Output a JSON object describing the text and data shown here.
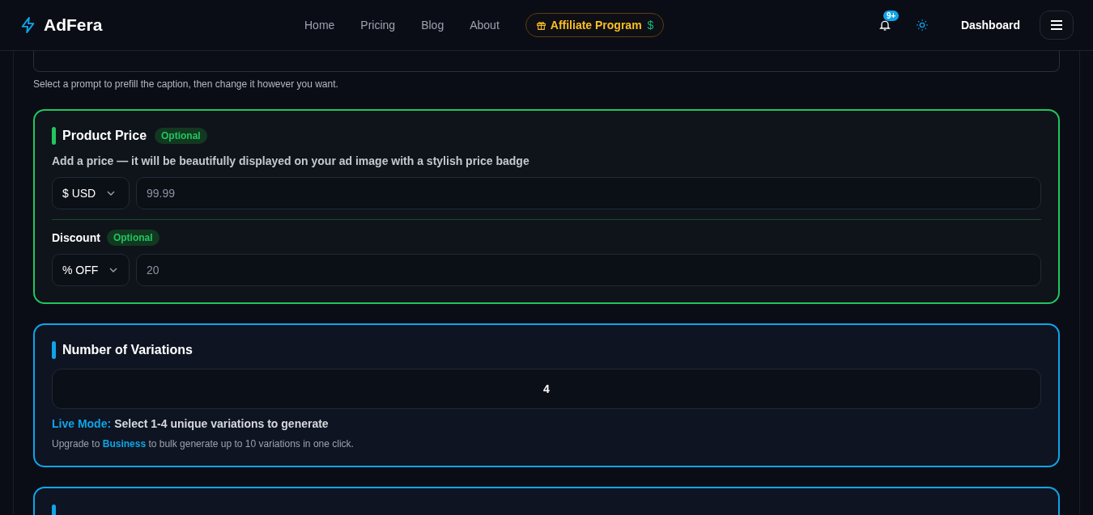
{
  "header": {
    "brand": "AdFera",
    "nav": [
      {
        "label": "Home"
      },
      {
        "label": "Pricing"
      },
      {
        "label": "Blog"
      },
      {
        "label": "About"
      }
    ],
    "affiliate": {
      "label": "Affiliate Program",
      "symbol": "$"
    },
    "notifications_badge": "9+",
    "dashboard": "Dashboard"
  },
  "caption_hint": "Select a prompt to prefill the caption, then change it however you want.",
  "sections": [
    {
      "kind": "price",
      "color": "#22c55e",
      "title": "Product Price",
      "badge": "Optional",
      "description": "Add a price — it will be beautifully displayed on your ad image with a stylish price badge",
      "currency": "$ USD",
      "price_value": "99.99",
      "discount_label": "Discount",
      "discount_badge": "Optional",
      "discount_type": "% OFF",
      "discount_value": "20"
    },
    {
      "kind": "variations",
      "color": "#0ea5e9",
      "title": "Number of Variations",
      "value": "4",
      "mode_label": "Live Mode:",
      "mode_text": "Select 1-4 unique variations to generate",
      "upgrade_prefix": "Upgrade to",
      "upgrade_link": "Business",
      "upgrade_suffix": "to bulk generate up to 10 variations in one click."
    },
    {
      "kind": "empty",
      "color": "#0ea5e9"
    }
  ]
}
